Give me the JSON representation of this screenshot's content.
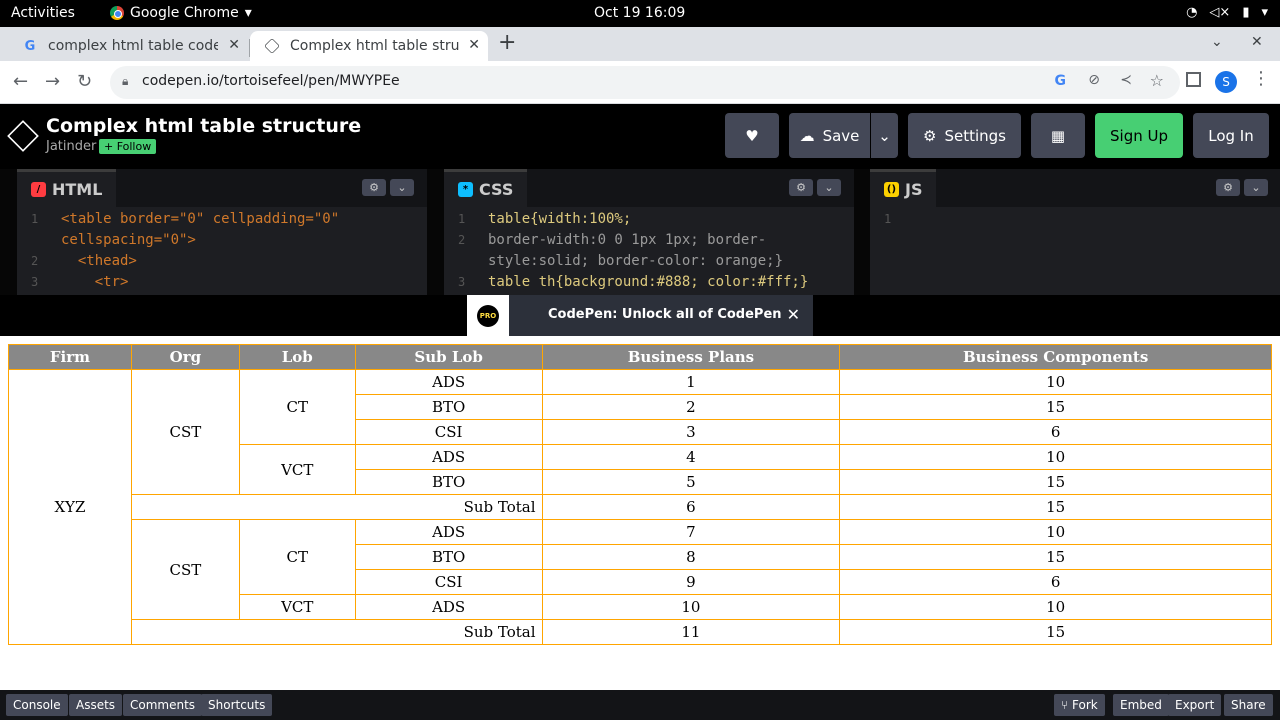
{
  "system_bar": {
    "activities": "Activities",
    "app_name": "Google Chrome",
    "clock": "Oct 19  16:09"
  },
  "browser": {
    "tabs": [
      {
        "title": "complex html table codepen",
        "favicon": "G"
      },
      {
        "title": "Complex html table structure",
        "favicon": "codepen"
      }
    ],
    "url": "codepen.io/tortoisefeel/pen/MWYPEe",
    "profile_initial": "S"
  },
  "pen": {
    "title": "Complex html table structure",
    "author": "Jatinder",
    "follow_label": "+ Follow",
    "buttons": {
      "save": "Save",
      "settings": "Settings",
      "signup": "Sign Up",
      "login": "Log In"
    }
  },
  "editors": {
    "html": {
      "label": "HTML",
      "lines": [
        {
          "no": "1",
          "text": "<table border=\"0\" cellpadding=\"0\""
        },
        {
          "no": "",
          "text": "cellspacing=\"0\">"
        },
        {
          "no": "2",
          "text": "  <thead>"
        },
        {
          "no": "3",
          "text": "    <tr>"
        }
      ]
    },
    "css": {
      "label": "CSS",
      "lines": [
        {
          "no": "1",
          "text": "table{width:100%;"
        },
        {
          "no": "2",
          "text": "border-width:0 0 1px 1px; border-"
        },
        {
          "no": "",
          "text": "style:solid; border-color: orange;}"
        },
        {
          "no": "3",
          "text": "table th{background:#888; color:#fff;}"
        }
      ]
    },
    "js": {
      "label": "JS",
      "lines": [
        {
          "no": "1",
          "text": ""
        }
      ]
    }
  },
  "promo": {
    "badge": "PRO",
    "message": "CodePen: Unlock all of CodePen"
  },
  "table": {
    "headers": [
      "Firm",
      "Org",
      "Lob",
      "Sub Lob",
      "Business Plans",
      "Business Components"
    ],
    "firm": "XYZ",
    "org1": "CST",
    "org2": "CST",
    "lob_ct1": "CT",
    "lob_vct1": "VCT",
    "lob_ct2": "CT",
    "lob_vct2": "VCT",
    "sub_total_label": "Sub Total",
    "rows": [
      {
        "sublob": "ADS",
        "plans": "1",
        "comps": "10"
      },
      {
        "sublob": "BTO",
        "plans": "2",
        "comps": "15"
      },
      {
        "sublob": "CSI",
        "plans": "3",
        "comps": "6"
      },
      {
        "sublob": "ADS",
        "plans": "4",
        "comps": "10"
      },
      {
        "sublob": "BTO",
        "plans": "5",
        "comps": "15"
      },
      {
        "sublob": "",
        "plans": "6",
        "comps": "15"
      },
      {
        "sublob": "ADS",
        "plans": "7",
        "comps": "10"
      },
      {
        "sublob": "BTO",
        "plans": "8",
        "comps": "15"
      },
      {
        "sublob": "CSI",
        "plans": "9",
        "comps": "6"
      },
      {
        "sublob": "ADS",
        "plans": "10",
        "comps": "10"
      },
      {
        "sublob": "",
        "plans": "11",
        "comps": "15"
      }
    ]
  },
  "bottom_bar": {
    "left": [
      "Console",
      "Assets",
      "Comments",
      "Shortcuts"
    ],
    "right": [
      "Fork",
      "Embed",
      "Export",
      "Share"
    ]
  }
}
